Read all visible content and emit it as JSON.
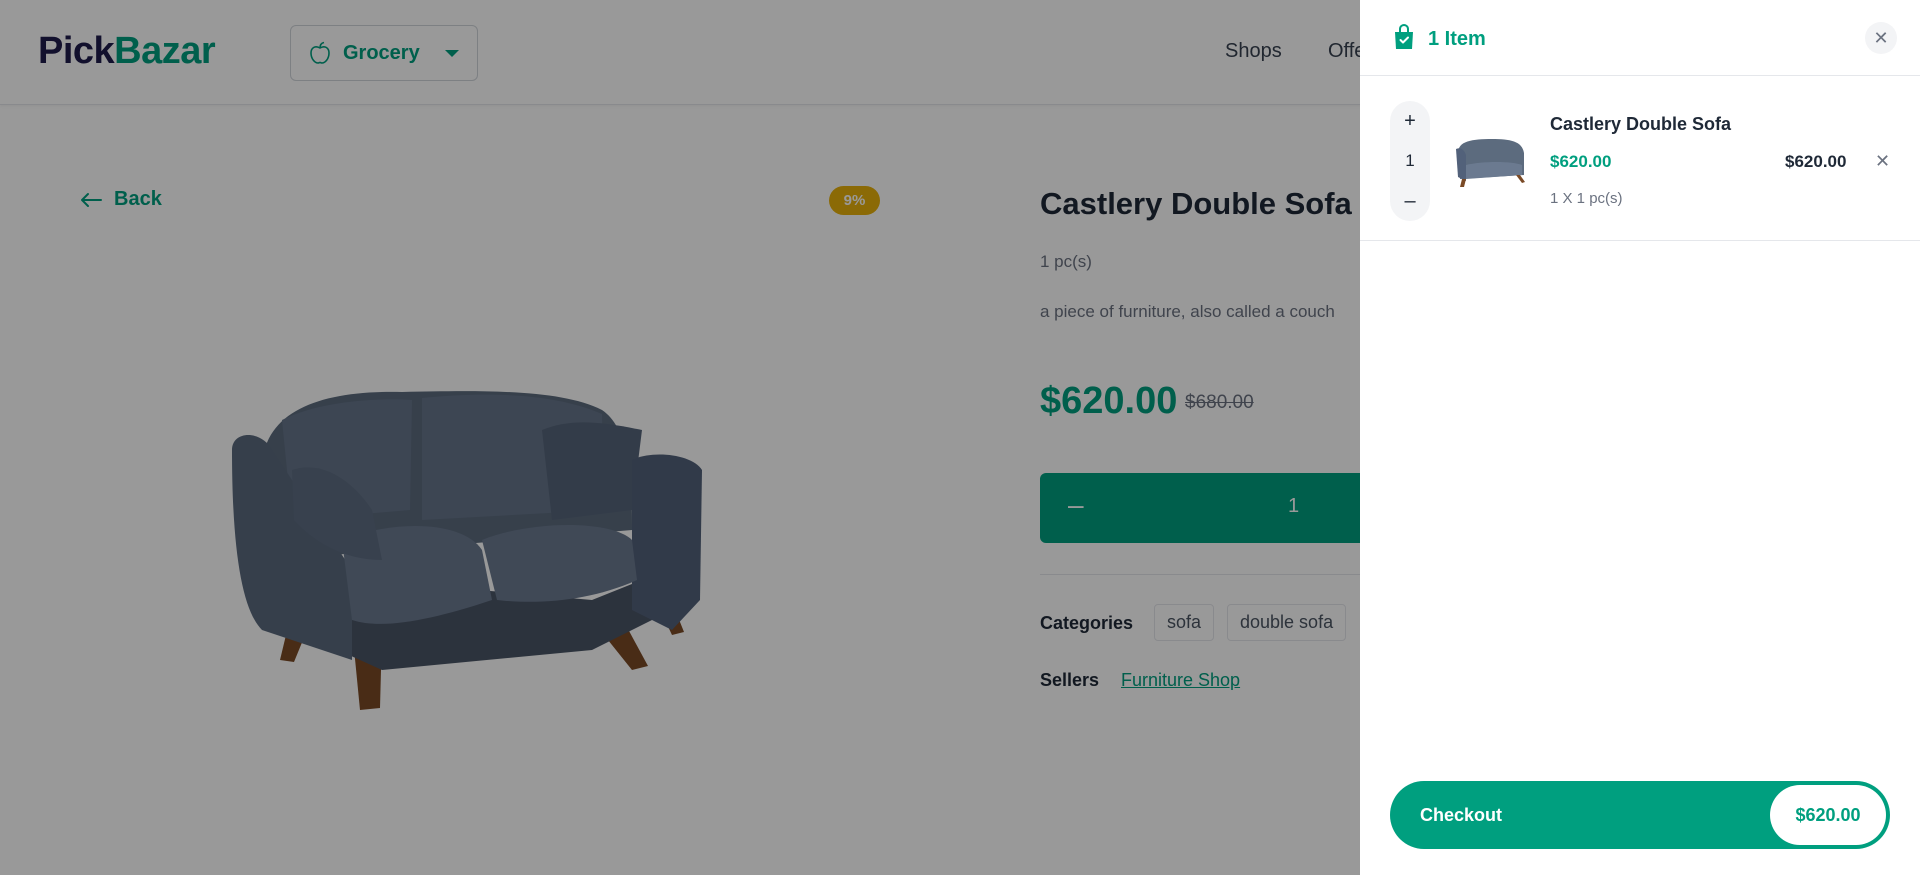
{
  "header": {
    "logo_part1": "Pick",
    "logo_part2": "Bazar",
    "type_selector": "Grocery",
    "nav": [
      "Shops",
      "Offers"
    ]
  },
  "product": {
    "back_label": "Back",
    "discount": "9%",
    "title": "Castlery Double Sofa",
    "unit": "1 pc(s)",
    "description": "a piece of furniture, also called a couch",
    "price": "$620.00",
    "old_price": "$680.00",
    "quantity": "1",
    "categories_label": "Categories",
    "categories": [
      "sofa",
      "double sofa"
    ],
    "sellers_label": "Sellers",
    "seller": "Furniture Shop"
  },
  "cart": {
    "count_label": "1 Item",
    "items": [
      {
        "name": "Castlery Double Sofa",
        "price": "$620.00",
        "qty": "1",
        "qty_detail": "1 X 1 pc(s)",
        "total": "$620.00"
      }
    ],
    "checkout_label": "Checkout",
    "checkout_total": "$620.00"
  },
  "colors": {
    "accent": "#009f7f",
    "logo_dark": "#1e1b4b",
    "discount_badge": "#e8b10b",
    "overlay": "rgba(0,0,0,0.4)"
  },
  "icons": [
    "apple-icon",
    "chevron-down-icon",
    "arrow-left-icon",
    "shopping-bag-icon",
    "close-icon",
    "plus-icon",
    "minus-icon",
    "remove-icon"
  ]
}
